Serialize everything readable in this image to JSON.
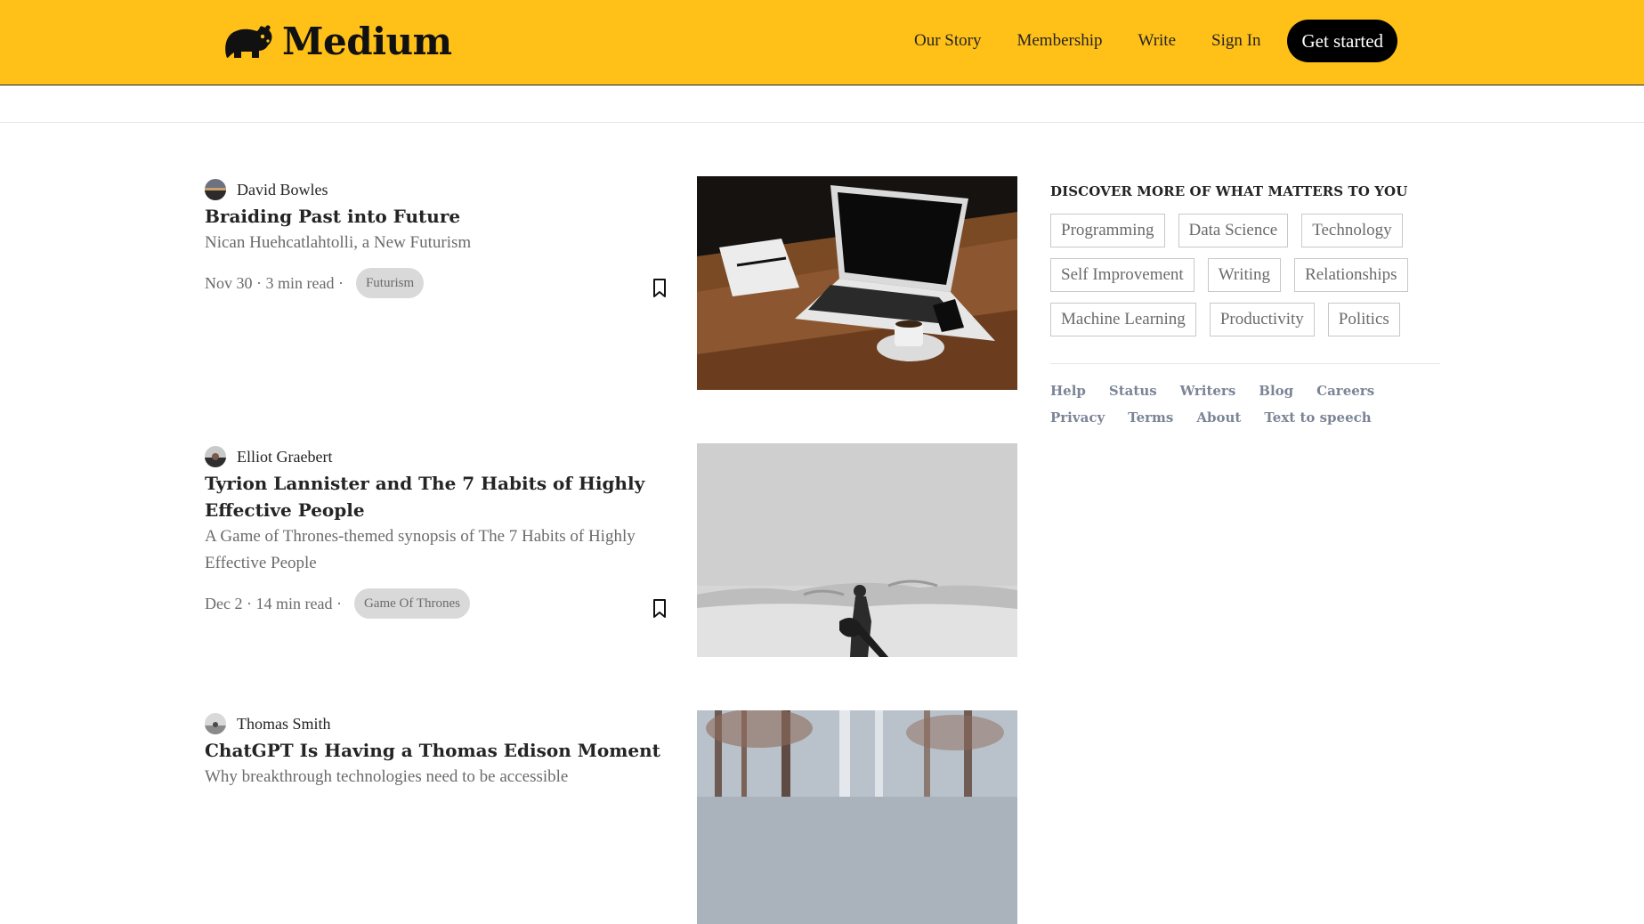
{
  "header": {
    "brand": "Medium",
    "nav": [
      "Our Story",
      "Membership",
      "Write",
      "Sign In"
    ],
    "cta": "Get started"
  },
  "posts": [
    {
      "author": "David Bowles",
      "title": "Braiding Past into Future",
      "subtitle": "Nican Huehcatlahtolli, a New Futurism",
      "meta": "Nov 30 · 3 min read ·",
      "tag": "Futurism"
    },
    {
      "author": "Elliot Graebert",
      "title": "Tyrion Lannister and The 7 Habits of Highly Effective People",
      "subtitle": "A Game of Thrones-themed synopsis of The 7 Habits of Highly Effective People",
      "meta": "Dec 2 · 14 min read ·",
      "tag": "Game Of Thrones"
    },
    {
      "author": "Thomas Smith",
      "title": "ChatGPT Is Having a Thomas Edison Moment",
      "subtitle": "Why breakthrough technologies need to be accessible"
    }
  ],
  "sidebar": {
    "heading": "DISCOVER MORE OF WHAT MATTERS TO YOU",
    "topics": [
      "Programming",
      "Data Science",
      "Technology",
      "Self Improvement",
      "Writing",
      "Relationships",
      "Machine Learning",
      "Productivity",
      "Politics"
    ],
    "footer": [
      "Help",
      "Status",
      "Writers",
      "Blog",
      "Careers",
      "Privacy",
      "Terms",
      "About",
      "Text to speech"
    ]
  },
  "colors": {
    "header_bg": "#ffc017",
    "text": "#242424",
    "muted": "#6b6b6b",
    "tag_bg": "#d9d9d9",
    "footer_link": "#7c8596"
  }
}
